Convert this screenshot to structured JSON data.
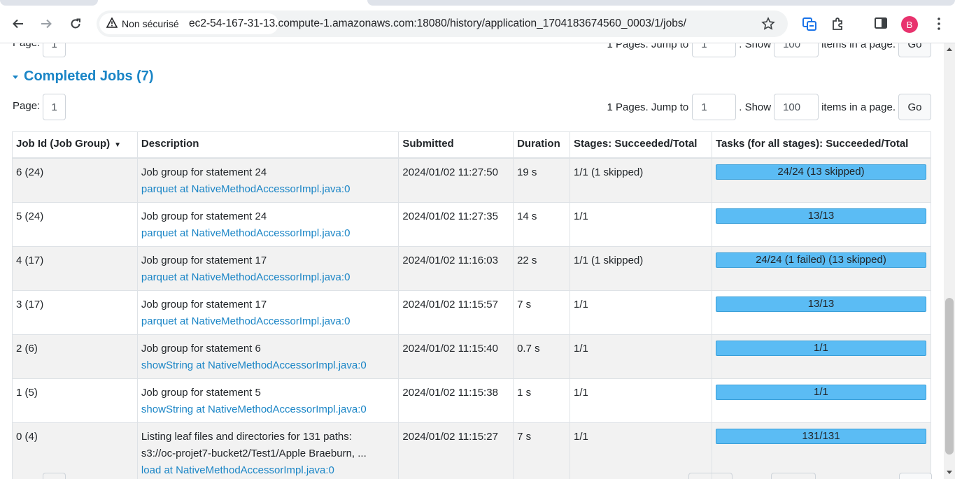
{
  "browser": {
    "security_label": "Non sécurisé",
    "url": "ec2-54-167-31-13.compute-1.amazonaws.com:18080/history/application_1704183674560_0003/1/jobs/",
    "avatar_letter": "B"
  },
  "top_pager": {
    "page_label": "Page:",
    "page_value": "1",
    "pages_text": "1 Pages. Jump to",
    "jump_value": "1",
    "show_text": ". Show",
    "show_value": "100",
    "items_text": "items in a page.",
    "go_label": "Go"
  },
  "section": {
    "title": "Completed Jobs (7)"
  },
  "pager": {
    "page_label": "Page:",
    "page_value": "1",
    "pages_text": "1 Pages. Jump to",
    "jump_value": "1",
    "show_text": ". Show",
    "show_value": "100",
    "items_text": "items in a page.",
    "go_label": "Go"
  },
  "table": {
    "headers": {
      "job_id": "Job Id (Job Group)",
      "sort_indicator": "▼",
      "description": "Description",
      "submitted": "Submitted",
      "duration": "Duration",
      "stages": "Stages: Succeeded/Total",
      "tasks": "Tasks (for all stages): Succeeded/Total"
    },
    "rows": [
      {
        "job_id": "6 (24)",
        "desc": "Job group for statement 24",
        "desc2": "",
        "link": "parquet at NativeMethodAccessorImpl.java:0",
        "submitted": "2024/01/02 11:27:50",
        "duration": "19 s",
        "stages": "1/1 (1 skipped)",
        "tasks": "24/24 (13 skipped)"
      },
      {
        "job_id": "5 (24)",
        "desc": "Job group for statement 24",
        "desc2": "",
        "link": "parquet at NativeMethodAccessorImpl.java:0",
        "submitted": "2024/01/02 11:27:35",
        "duration": "14 s",
        "stages": "1/1",
        "tasks": "13/13"
      },
      {
        "job_id": "4 (17)",
        "desc": "Job group for statement 17",
        "desc2": "",
        "link": "parquet at NativeMethodAccessorImpl.java:0",
        "submitted": "2024/01/02 11:16:03",
        "duration": "22 s",
        "stages": "1/1 (1 skipped)",
        "tasks": "24/24 (1 failed) (13 skipped)"
      },
      {
        "job_id": "3 (17)",
        "desc": "Job group for statement 17",
        "desc2": "",
        "link": "parquet at NativeMethodAccessorImpl.java:0",
        "submitted": "2024/01/02 11:15:57",
        "duration": "7 s",
        "stages": "1/1",
        "tasks": "13/13"
      },
      {
        "job_id": "2 (6)",
        "desc": "Job group for statement 6",
        "desc2": "",
        "link": "showString at NativeMethodAccessorImpl.java:0",
        "submitted": "2024/01/02 11:15:40",
        "duration": "0.7 s",
        "stages": "1/1",
        "tasks": "1/1"
      },
      {
        "job_id": "1 (5)",
        "desc": "Job group for statement 5",
        "desc2": "",
        "link": "showString at NativeMethodAccessorImpl.java:0",
        "submitted": "2024/01/02 11:15:38",
        "duration": "1 s",
        "stages": "1/1",
        "tasks": "1/1"
      },
      {
        "job_id": "0 (4)",
        "desc": "Listing leaf files and directories for 131 paths:",
        "desc2": "s3://oc-projet7-bucket2/Test1/Apple Braeburn, ...",
        "link": "load at NativeMethodAccessorImpl.java:0",
        "submitted": "2024/01/02 11:15:27",
        "duration": "7 s",
        "stages": "1/1",
        "tasks": "131/131"
      }
    ]
  },
  "colors": {
    "accent": "#1a85c6",
    "progress_fill": "#5bbcf4",
    "row_alt": "#f2f2f2"
  }
}
